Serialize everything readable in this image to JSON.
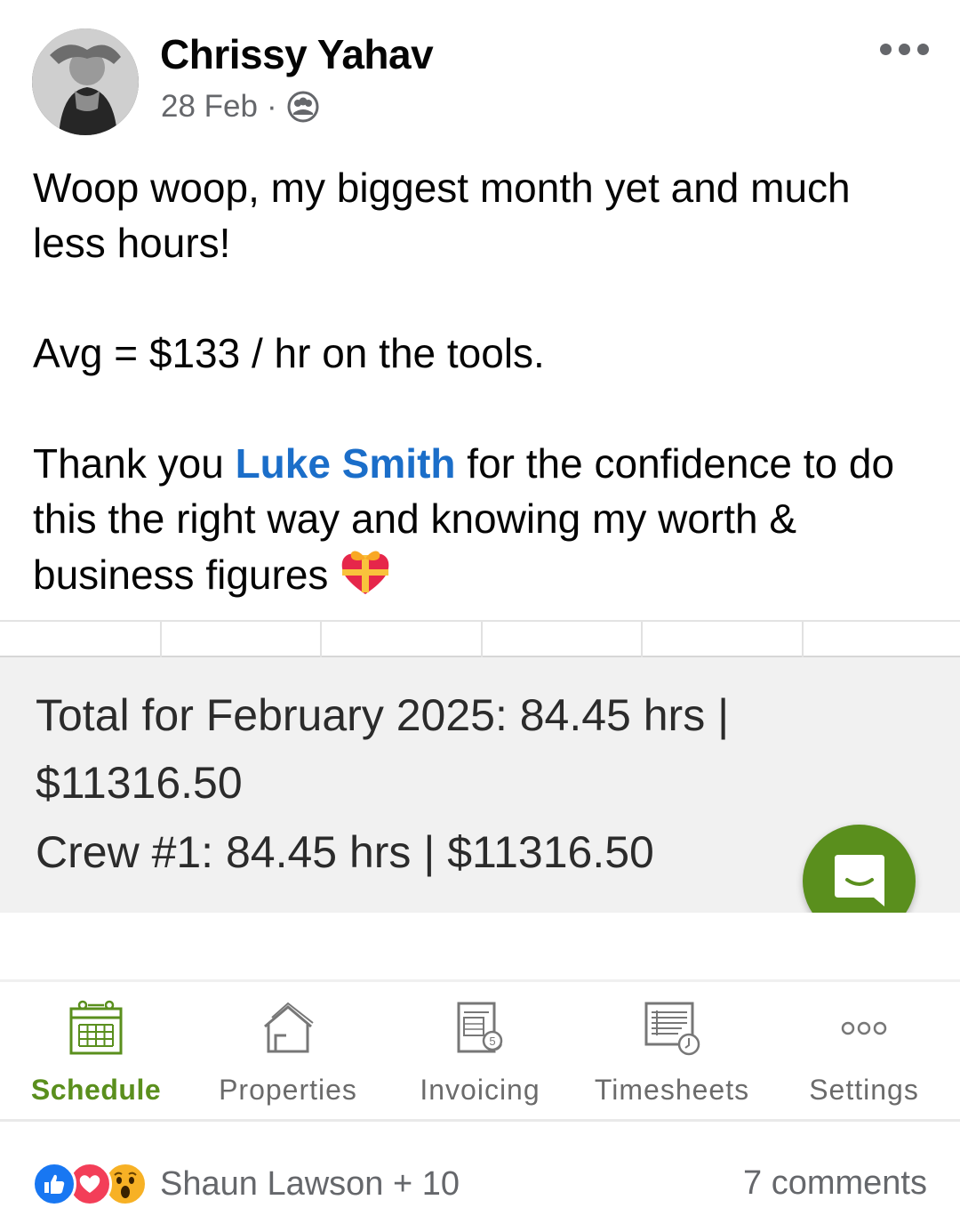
{
  "post": {
    "author_name": "Chrissy Yahav",
    "date": "28 Feb",
    "separator": "·",
    "audience_icon": "group-icon",
    "text_line1": "Woop woop, my biggest month yet and much less hours!",
    "text_line2": "Avg = $133 / hr on the tools.",
    "text_line3_before": "Thank you ",
    "mention": "Luke Smith",
    "text_line3_after": " for the confidence to do this the right way and knowing my worth & business figures",
    "emoji": "heart-with-ribbon-emoji",
    "accent_color": "#1b6ec9"
  },
  "screenshot": {
    "summary_line1": "Total for February 2025: 84.45 hrs |",
    "summary_line2": "$11316.50",
    "summary_line3": "Crew #1: 84.45 hrs | $11316.50",
    "brand_color": "#5a8f1d",
    "chat_icon": "chat-bubble-icon",
    "tabs": [
      {
        "label": "Schedule",
        "icon": "calendar-icon",
        "active": true
      },
      {
        "label": "Properties",
        "icon": "house-icon",
        "active": false
      },
      {
        "label": "Invoicing",
        "icon": "invoice-icon",
        "active": false
      },
      {
        "label": "Timesheets",
        "icon": "timesheet-icon",
        "active": false
      },
      {
        "label": "Settings",
        "icon": "more-dots-icon",
        "active": false
      }
    ]
  },
  "footer": {
    "reaction_icons": [
      "like-icon",
      "love-icon",
      "wow-icon"
    ],
    "reactions_text": "Shaun Lawson + 10",
    "comments_text": "7 comments"
  }
}
